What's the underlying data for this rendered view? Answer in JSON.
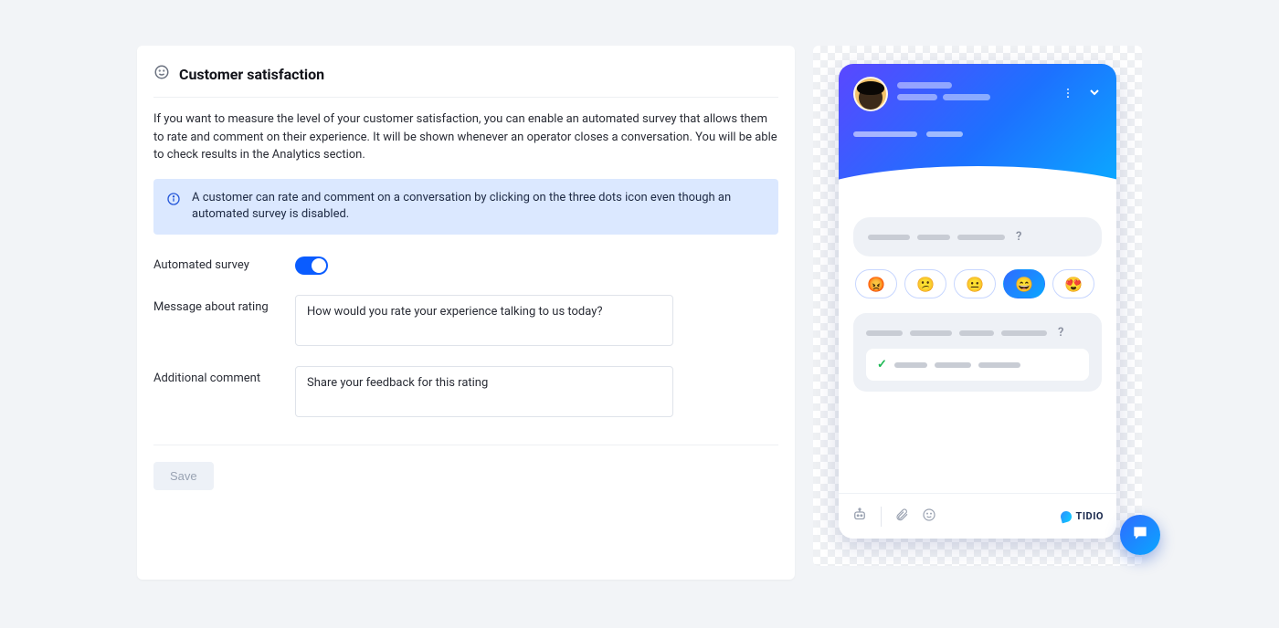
{
  "page": {
    "title": "Customer satisfaction",
    "description": "If you want to measure the level of your customer satisfaction, you can enable an automated survey that allows them to rate and comment on their experience. It will be shown whenever an operator closes a conversation. You will be able to check results in the Analytics section.",
    "info_note": "A customer can rate and comment on a conversation by clicking on the three dots icon even though an automated survey is disabled."
  },
  "form": {
    "automated_survey_label": "Automated survey",
    "automated_survey_on": true,
    "message_label": "Message about rating",
    "message_value": "How would you rate your experience talking to us today?",
    "comment_label": "Additional comment",
    "comment_value": "Share your feedback for this rating",
    "save_label": "Save"
  },
  "preview": {
    "brand": "TIDIO",
    "emojis": [
      "😡",
      "😕",
      "😐",
      "😄",
      "😍"
    ],
    "selected_emoji_index": 3
  },
  "icons": {
    "smiley": "smiley-icon",
    "info": "info-icon",
    "more_vertical": "more-vertical-icon",
    "chevron_down": "chevron-down-icon",
    "bot": "bot-icon",
    "paperclip": "paperclip-icon",
    "emoji_picker": "emoji-icon",
    "chat_bubble": "chat-bubble-icon"
  }
}
